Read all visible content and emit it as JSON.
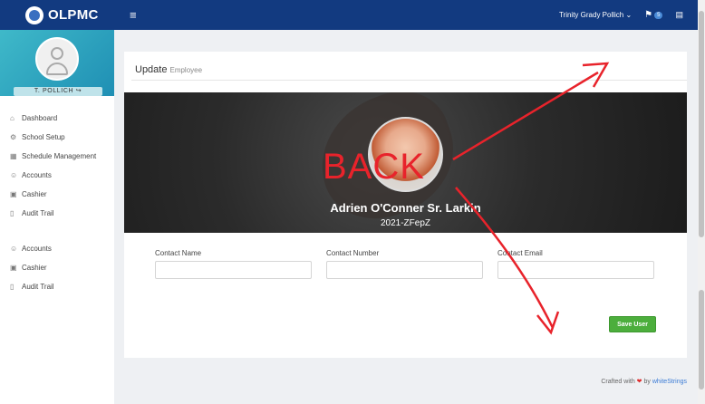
{
  "brand": {
    "name": "OLPMC"
  },
  "topbar": {
    "menu_icon": "hamburger-icon",
    "user": "Trinity Grady Pollich",
    "notif_count": "5"
  },
  "sidebar": {
    "username": "T. POLLICH",
    "items": [
      {
        "label": "Dashboard",
        "icon": "home-icon"
      },
      {
        "label": "School Setup",
        "icon": "gear-icon"
      },
      {
        "label": "Schedule Management",
        "icon": "calendar-icon"
      },
      {
        "label": "Accounts",
        "icon": "users-icon"
      },
      {
        "label": "Cashier",
        "icon": "cash-icon"
      },
      {
        "label": "Audit Trail",
        "icon": "file-icon"
      }
    ],
    "items2": [
      {
        "label": "Accounts",
        "icon": "users-icon"
      },
      {
        "label": "Cashier",
        "icon": "cash-icon"
      },
      {
        "label": "Audit Trail",
        "icon": "file-icon"
      }
    ]
  },
  "page": {
    "title": "Update",
    "subtitle": "Employee"
  },
  "profile": {
    "name": "Adrien O'Conner Sr. Larkin",
    "id": "2021-ZFepZ"
  },
  "annotation": {
    "text": "BACK",
    "color": "#e8232b"
  },
  "form": {
    "contact_name_label": "Contact Name",
    "contact_number_label": "Contact Number",
    "contact_email_label": "Contact Email",
    "save_label": "Save User"
  },
  "footer": {
    "prefix": "Crafted with",
    "by": "by",
    "link": "whiteStrings"
  }
}
